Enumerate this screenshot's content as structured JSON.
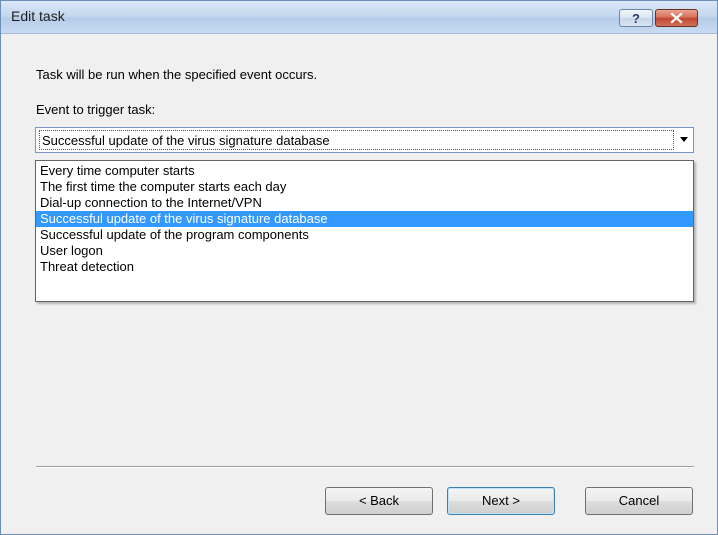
{
  "window": {
    "title": "Edit task"
  },
  "titlebar_buttons": {
    "help_icon": "question-mark",
    "close_icon": "x-mark"
  },
  "content": {
    "instruction": "Task will be run when the specified event occurs.",
    "event_label": "Event to trigger task:",
    "event_select": {
      "selected_value": "Successful update of the virus signature database",
      "expanded": true,
      "options": [
        "Every time computer starts",
        "The first time the computer starts each day",
        "Dial-up connection to the Internet/VPN",
        "Successful update of the virus signature database",
        "Successful update of the program components",
        "User logon",
        "Threat detection"
      ],
      "highlighted_index": 3
    }
  },
  "footer": {
    "back_label": "< Back",
    "next_label": "Next >",
    "cancel_label": "Cancel"
  },
  "colors": {
    "selection_highlight": "#3399ff",
    "close_button": "#c1472f",
    "window_background": "#f0f0f0"
  }
}
